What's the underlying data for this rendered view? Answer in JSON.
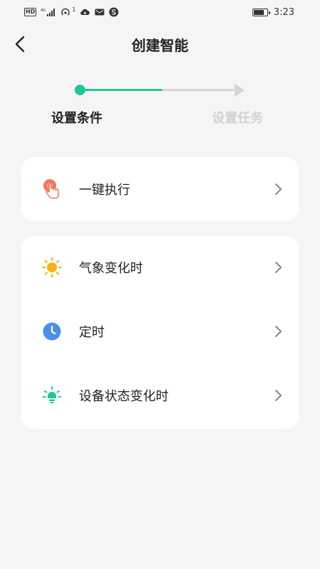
{
  "status_bar": {
    "hd_label": "HD",
    "network_label": "4G",
    "hotspot_count": "1",
    "time": "3:23",
    "battery_level": 0.85
  },
  "header": {
    "title": "创建智能"
  },
  "stepper": {
    "current_step": 1,
    "steps": [
      {
        "label": "设置条件",
        "active": true
      },
      {
        "label": "设置任务",
        "active": false
      }
    ],
    "accent_color": "#1fc69a",
    "inactive_color": "#d4d4d4"
  },
  "conditions": {
    "group1": [
      {
        "label": "一键执行",
        "icon": "tap-hand-icon"
      }
    ],
    "group2": [
      {
        "label": "气象变化时",
        "icon": "sun-icon"
      },
      {
        "label": "定时",
        "icon": "clock-icon"
      },
      {
        "label": "设备状态变化时",
        "icon": "bulb-icon"
      }
    ]
  }
}
